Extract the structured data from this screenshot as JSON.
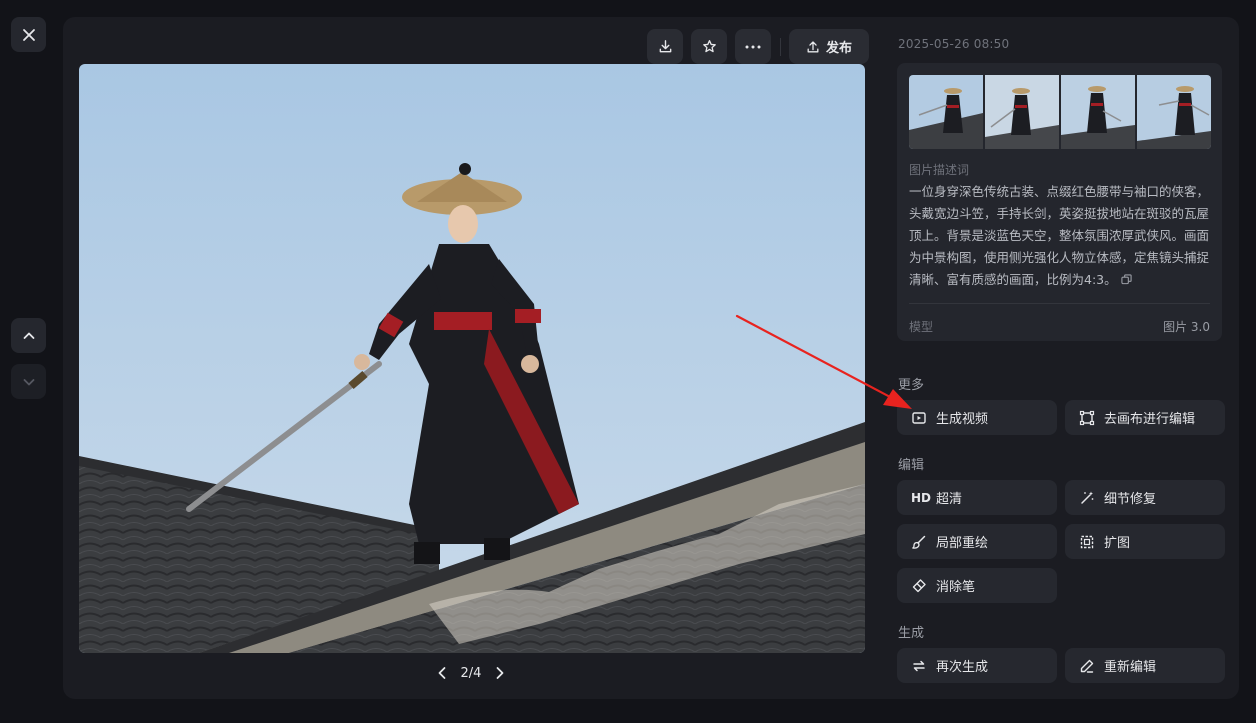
{
  "viewer": {
    "timestamp": "2025-05-26 08:50",
    "pager": {
      "current": 2,
      "total": 4,
      "label": "2/4"
    }
  },
  "toolbar": {
    "download_icon": "download-icon",
    "favorite_icon": "star-icon",
    "more_icon": "more-dots-icon",
    "publish_label": "发布"
  },
  "info": {
    "description_label": "图片描述词",
    "description": "一位身穿深色传统古装、点缀红色腰带与袖口的侠客，头戴宽边斗笠，手持长剑，英姿挺拔地站在斑驳的瓦屋顶上。背景是淡蓝色天空，整体氛围浓厚武侠风。画面为中景构图，使用侧光强化人物立体感，定焦镜头捕捉清晰、富有质感的画面，比例为4:3。",
    "model_label": "模型",
    "model_value": "图片 3.0"
  },
  "sections": {
    "more": "更多",
    "edit": "编辑",
    "generate": "生成"
  },
  "actions": {
    "generate_video": "生成视频",
    "canvas_edit": "去画布进行编辑",
    "hd_glyph": "HD",
    "super_res": "超清",
    "detail_fix": "细节修复",
    "inpaint": "局部重绘",
    "expand": "扩图",
    "eraser": "消除笔",
    "regenerate": "再次生成",
    "re_edit": "重新编辑"
  },
  "colors": {
    "background": "#121318",
    "panel": "#1b1c22",
    "button": "#26282f",
    "annotation_arrow": "#e8231f"
  }
}
